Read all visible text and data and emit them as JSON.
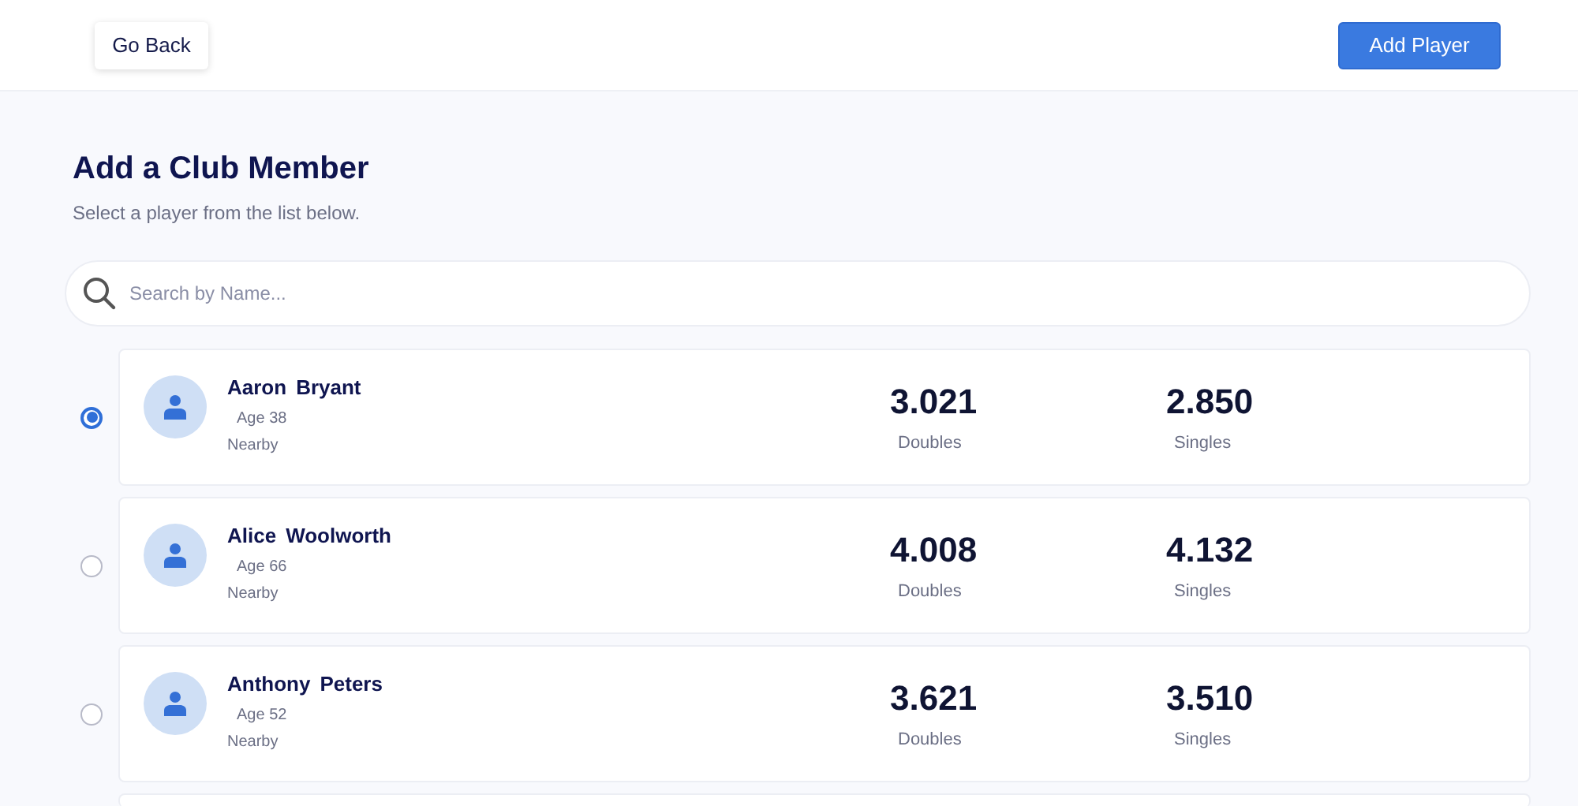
{
  "header": {
    "back_button": "Go Back",
    "add_button": "Add Player"
  },
  "title": "Add a Club Member",
  "subtitle": "Select a player from the list below.",
  "search": {
    "placeholder": "Search by Name..."
  },
  "players": [
    {
      "first_name": "Aaron",
      "last_name": "Bryant",
      "age": "Age 38",
      "location": "Nearby",
      "doubles": "3.021",
      "doubles_label": "Doubles",
      "singles": "2.850",
      "singles_label": "Singles",
      "selected": true
    },
    {
      "first_name": "Alice",
      "last_name": "Woolworth",
      "age": "Age 66",
      "location": "Nearby",
      "doubles": "4.008",
      "doubles_label": "Doubles",
      "singles": "4.132",
      "singles_label": "Singles",
      "selected": false
    },
    {
      "first_name": "Anthony",
      "last_name": "Peters",
      "age": "Age 52",
      "location": "Nearby",
      "doubles": "3.621",
      "doubles_label": "Doubles",
      "singles": "3.510",
      "singles_label": "Singles",
      "selected": false
    }
  ]
}
